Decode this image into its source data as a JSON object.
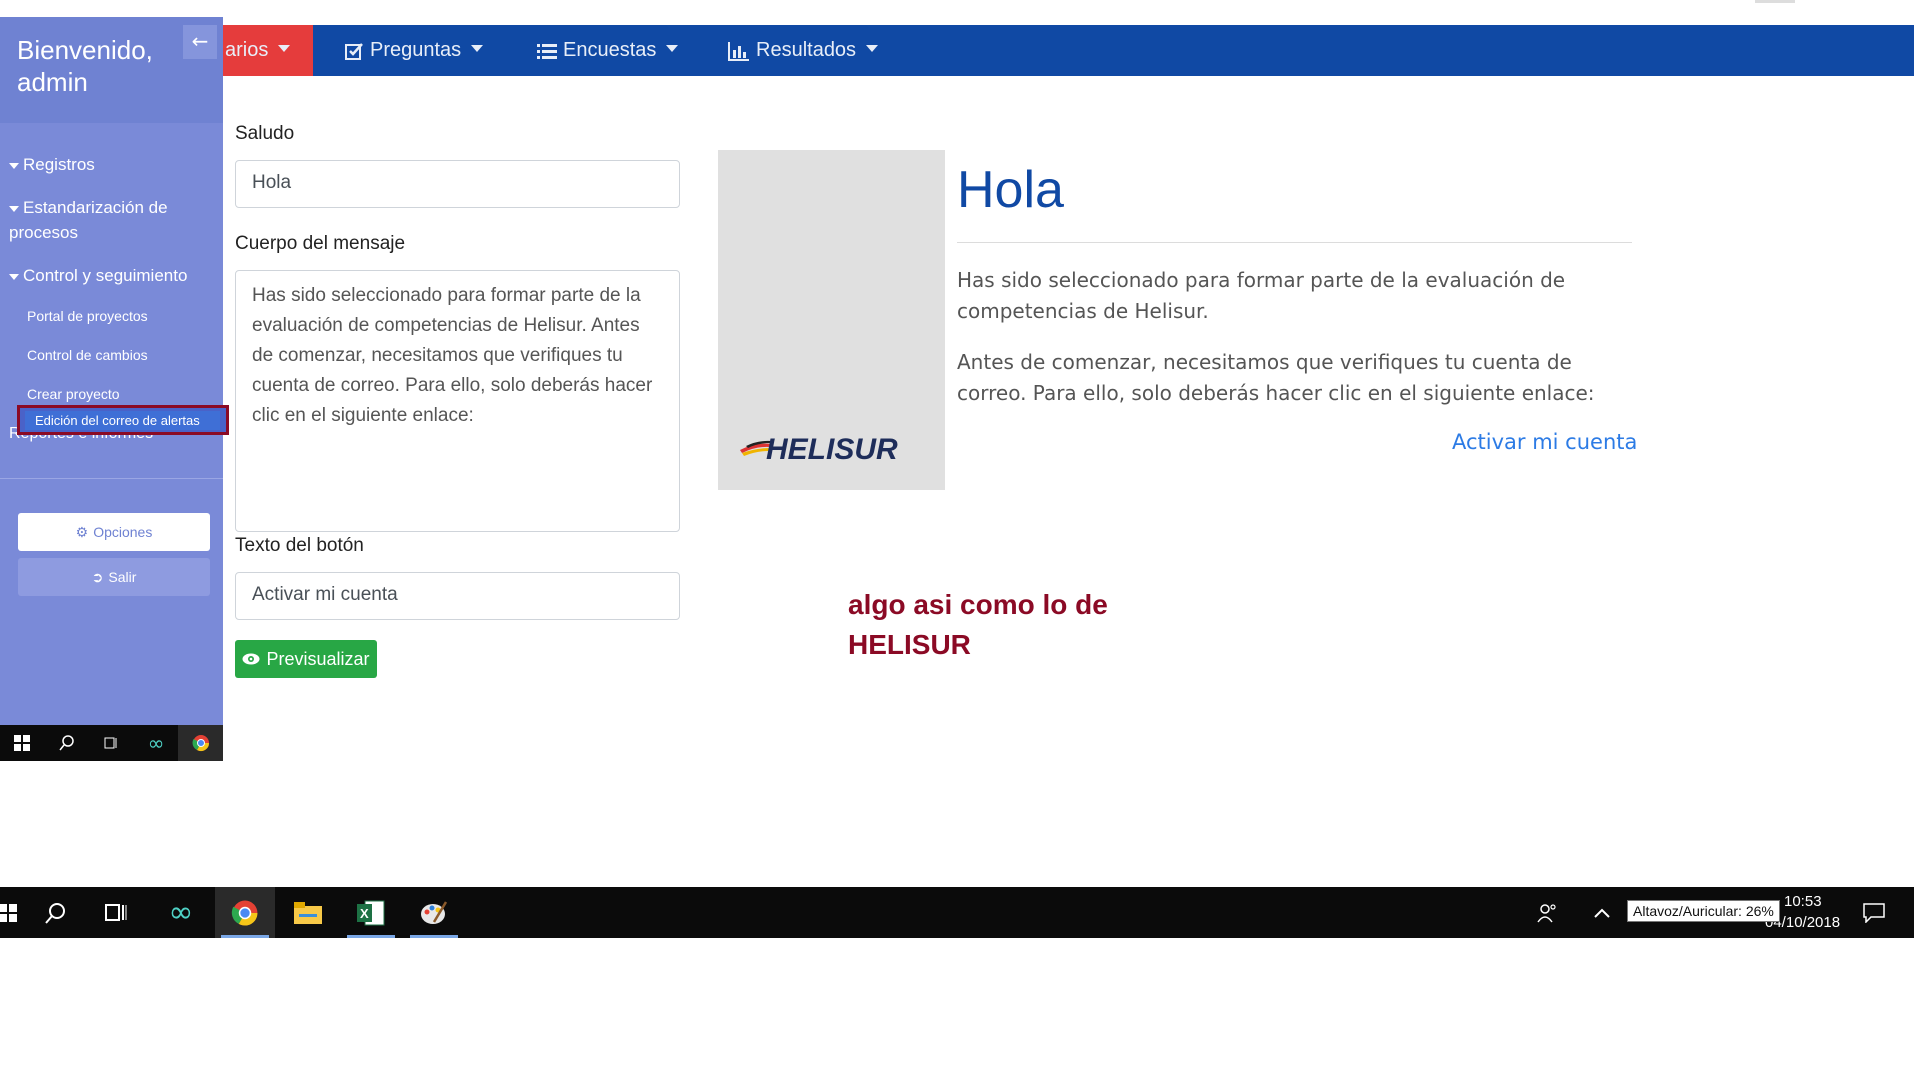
{
  "sidebar": {
    "welcome": "Bienvenido, admin",
    "sections": [
      {
        "label": "Registros"
      },
      {
        "label": "Estandarización de procesos"
      },
      {
        "label": "Control y seguimiento"
      }
    ],
    "items": [
      "Portal de proyectos",
      "Control de cambios",
      "Crear proyecto"
    ],
    "highlight": "Edición del correo de alertas",
    "reports": "Reportes e informes",
    "options_button": "Opciones",
    "exit_button": "Salir"
  },
  "navbar": {
    "items": [
      "arios",
      "Preguntas",
      "Encuestas",
      "Resultados"
    ]
  },
  "form": {
    "greeting_label": "Saludo",
    "greeting_value": "Hola",
    "body_label": "Cuerpo del mensaje",
    "body_value": "Has sido seleccionado para formar parte de la evaluación de competencias de Helisur. Antes de comenzar, necesitamos que verifiques tu cuenta de correo. Para ello, solo deberás hacer clic en el siguiente enlace:",
    "button_text_label": "Texto del botón",
    "button_text_value": "Activar mi cuenta",
    "preview_button": "Previsualizar"
  },
  "preview": {
    "logo_text": "HELISUR",
    "title": "Hola",
    "paragraph1": "Has sido seleccionado para formar parte de la evaluación de competencias de Helisur.",
    "paragraph2": "Antes de comenzar, necesitamos que verifiques tu cuenta de correo. Para ello, solo deberás hacer clic en el siguiente enlace:",
    "link": "Activar mi cuenta"
  },
  "note": "algo asi como lo de HELISUR",
  "taskbar": {
    "tooltip": "Altavoz/Auricular: 26%",
    "time": "10:53",
    "date": "04/10/2018",
    "icons": [
      "windows-icon",
      "search-icon",
      "task-view-icon",
      "infinity-icon",
      "chrome-icon",
      "file-explorer-icon",
      "excel-icon",
      "paint-icon"
    ]
  },
  "colors": {
    "navbar": "#1049a4",
    "sidebar": "#7a8ad8",
    "accent_red": "#e53c3c",
    "success": "#28a745",
    "note": "#8b0a25"
  }
}
